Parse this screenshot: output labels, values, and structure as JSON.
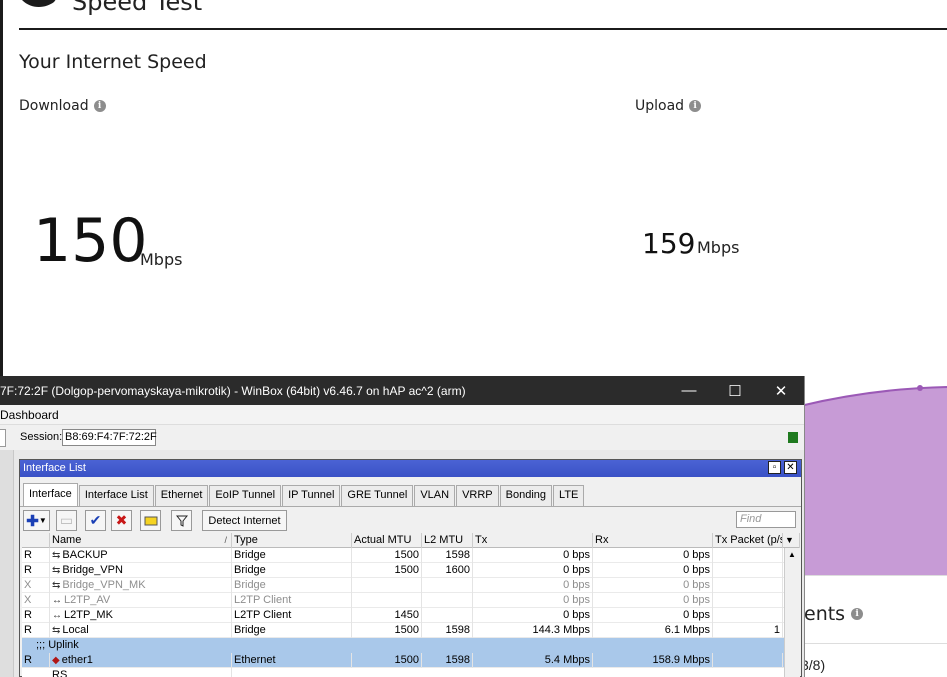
{
  "speedtest": {
    "title": "Speed Test",
    "heading": "Your Internet Speed",
    "download": {
      "label": "Download",
      "value": "150",
      "unit": "Mbps"
    },
    "upload": {
      "label": "Upload",
      "value": "159",
      "unit": "Mbps"
    },
    "clients_fragment": "ents",
    "small_fragment": "3/8)",
    "colors": {
      "chart_fill": "#b57ccb",
      "chart_line": "#9b59b6"
    }
  },
  "winbox": {
    "title": "7F:72:2F (Dolgop-pervomayskaya-mikrotik) - WinBox (64bit) v6.46.7 on hAP ac^2 (arm)",
    "menu": "Dashboard",
    "session_label": "Session:",
    "session_value": "B8:69:F4:7F:72:2F",
    "controls": {
      "minimize": "—",
      "maximize": "☐",
      "close": "✕"
    }
  },
  "interface_list": {
    "title": "Interface List",
    "tabs": [
      "Interface",
      "Interface List",
      "Ethernet",
      "EoIP Tunnel",
      "IP Tunnel",
      "GRE Tunnel",
      "VLAN",
      "VRRP",
      "Bonding",
      "LTE"
    ],
    "detect_internet": "Detect Internet",
    "find_placeholder": "Find",
    "columns": [
      "Name",
      "Type",
      "Actual MTU",
      "L2 MTU",
      "Tx",
      "Rx",
      "Tx Packet (p/s"
    ],
    "rows": [
      {
        "flag": "R",
        "name": "BACKUP",
        "type": "Bridge",
        "mtu": "1500",
        "l2mtu": "1598",
        "tx": "0 bps",
        "rx": "0 bps",
        "txp": ""
      },
      {
        "flag": "R",
        "name": "Bridge_VPN",
        "type": "Bridge",
        "mtu": "1500",
        "l2mtu": "1600",
        "tx": "0 bps",
        "rx": "0 bps",
        "txp": ""
      },
      {
        "flag": "X",
        "name": "Bridge_VPN_MK",
        "type": "Bridge",
        "mtu": "",
        "l2mtu": "",
        "tx": "0 bps",
        "rx": "0 bps",
        "txp": ""
      },
      {
        "flag": "X",
        "name": "L2TP_AV",
        "type": "L2TP Client",
        "mtu": "",
        "l2mtu": "",
        "tx": "0 bps",
        "rx": "0 bps",
        "txp": ""
      },
      {
        "flag": "R",
        "name": "L2TP_MK",
        "type": "L2TP Client",
        "mtu": "1450",
        "l2mtu": "",
        "tx": "0 bps",
        "rx": "0 bps",
        "txp": ""
      },
      {
        "flag": "R",
        "name": "Local",
        "type": "Bridge",
        "mtu": "1500",
        "l2mtu": "1598",
        "tx": "144.3 Mbps",
        "rx": "6.1 Mbps",
        "txp": "1"
      }
    ],
    "comment": ";;; Uplink",
    "selected_row": {
      "flag": "R",
      "name": "ether1",
      "type": "Ethernet",
      "mtu": "1500",
      "l2mtu": "1598",
      "tx": "5.4 Mbps",
      "rx": "158.9 Mbps",
      "txp": ""
    },
    "next_row_fragment": "RS"
  }
}
